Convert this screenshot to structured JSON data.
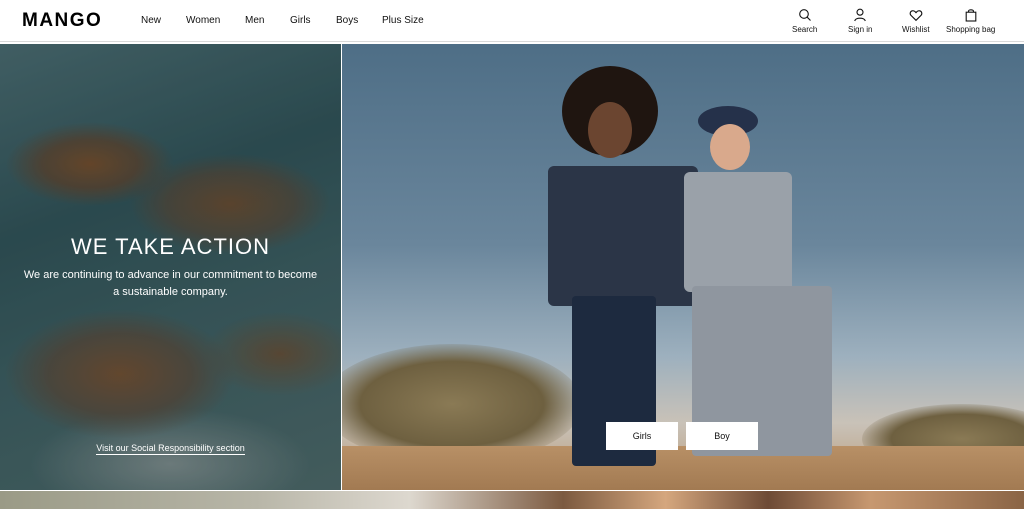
{
  "brand": {
    "logo": "MANGO"
  },
  "nav": {
    "items": [
      {
        "label": "New"
      },
      {
        "label": "Women"
      },
      {
        "label": "Men"
      },
      {
        "label": "Girls"
      },
      {
        "label": "Boys"
      },
      {
        "label": "Plus Size"
      }
    ]
  },
  "actions": {
    "search": {
      "label": "Search",
      "icon": "search-icon"
    },
    "signin": {
      "label": "Sign in",
      "icon": "user-icon"
    },
    "wishlist": {
      "label": "Wishlist",
      "icon": "heart-icon"
    },
    "bag": {
      "label": "Shopping bag",
      "icon": "bag-icon"
    }
  },
  "hero_left": {
    "title": "WE TAKE ACTION",
    "subtitle": "We are continuing to advance in our commitment to become a sustainable company.",
    "link": "Visit our Social Responsibility section"
  },
  "hero_right": {
    "buttons": [
      {
        "label": "Girls"
      },
      {
        "label": "Boy"
      }
    ]
  },
  "colors": {
    "text": "#111111",
    "background": "#ffffff",
    "cta_bg": "#ffffff"
  }
}
